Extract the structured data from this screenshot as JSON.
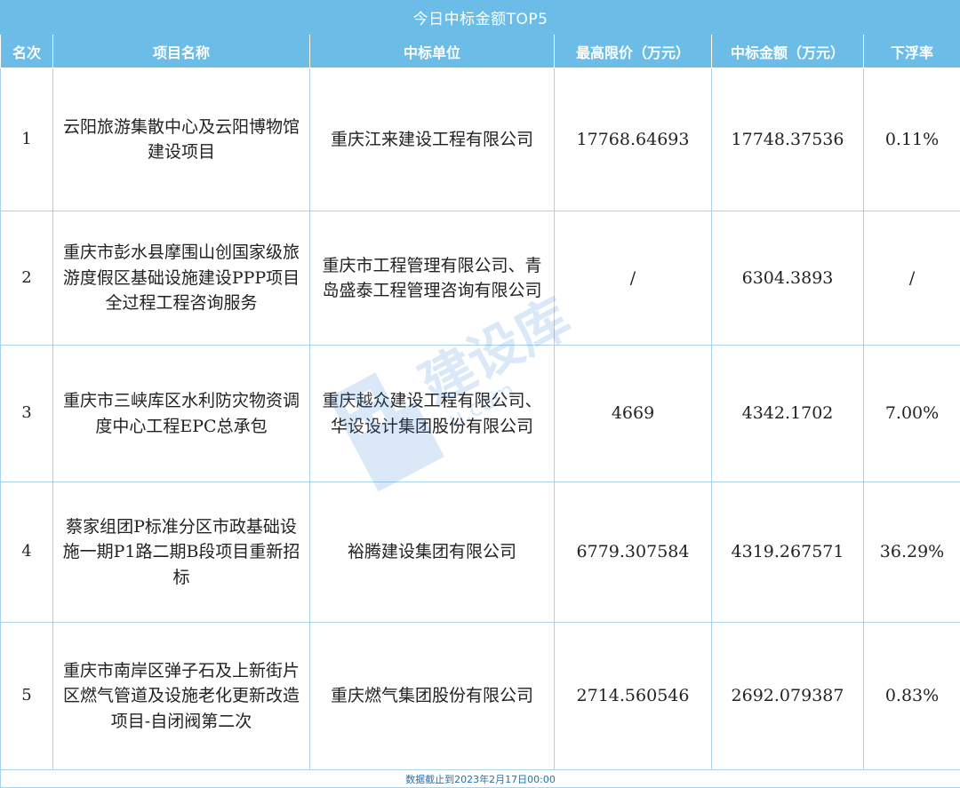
{
  "table": {
    "title": "今日中标金额TOP5",
    "headers": [
      "名次",
      "项目名称",
      "中标单位",
      "最高限价（万元）",
      "中标金额（万元）",
      "下浮率"
    ],
    "rows": [
      {
        "rank": "1",
        "project": "云阳旅游集散中心及云阳博物馆建设项目",
        "winner": "重庆江来建设工程有限公司",
        "max_price": "17768.64693",
        "bid_amount": "17748.37536",
        "discount": "0.11%"
      },
      {
        "rank": "2",
        "project": "重庆市彭水县摩围山创国家级旅游度假区基础设施建设PPP项目全过程工程咨询服务",
        "winner": "重庆市工程管理有限公司、青岛盛泰工程管理咨询有限公司",
        "max_price": "/",
        "bid_amount": "6304.3893",
        "discount": "/"
      },
      {
        "rank": "3",
        "project": "重庆市三峡库区水利防灾物资调度中心工程EPC总承包",
        "winner": "重庆越众建设工程有限公司、华设设计集团股份有限公司",
        "max_price": "4669",
        "bid_amount": "4342.1702",
        "discount": "7.00%"
      },
      {
        "rank": "4",
        "project": "蔡家组团P标准分区市政基础设施一期P1路二期B段项目重新招标",
        "winner": "裕腾建设集团有限公司",
        "max_price": "6779.307584",
        "bid_amount": "4319.267571",
        "discount": "36.29%"
      },
      {
        "rank": "5",
        "project": "重庆市南岸区弹子石及上新街片区燃气管道及设施老化更新改造项目-自闭阀第二次",
        "winner": "重庆燃气集团股份有限公司",
        "max_price": "2714.560546",
        "bid_amount": "2692.079387",
        "discount": "0.83%"
      }
    ],
    "footer": "数据截止到2023年2月17日00:00"
  },
  "watermark": {
    "text": "建设库",
    "url": "u.com",
    "color": "#1e78d6"
  },
  "colors": {
    "header_bg": "#6bbde8",
    "border": "#a8d3e8",
    "footer_text": "#2d6fa8"
  }
}
